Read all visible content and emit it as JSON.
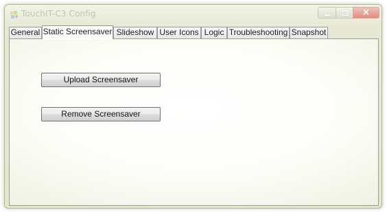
{
  "window": {
    "title": "TouchIT-C3 Config",
    "controls": {
      "minimize_icon": "minimize-icon",
      "maximize_icon": "maximize-icon",
      "close_icon": "close-icon",
      "close_glyph": "×"
    }
  },
  "tabs": [
    {
      "label": "General",
      "active": false
    },
    {
      "label": "Static Screensaver",
      "active": true
    },
    {
      "label": "Slideshow",
      "active": false
    },
    {
      "label": "User Icons",
      "active": false
    },
    {
      "label": "Logic",
      "active": false
    },
    {
      "label": "Troubleshooting",
      "active": false
    },
    {
      "label": "Snapshot",
      "active": false
    }
  ],
  "panel": {
    "upload_label": "Upload Screensaver",
    "remove_label": "Remove Screensaver"
  },
  "colors": {
    "window_bg": "#e4e6cf",
    "close_button": "#e08d7d",
    "title_text": "#c0c2b4"
  }
}
